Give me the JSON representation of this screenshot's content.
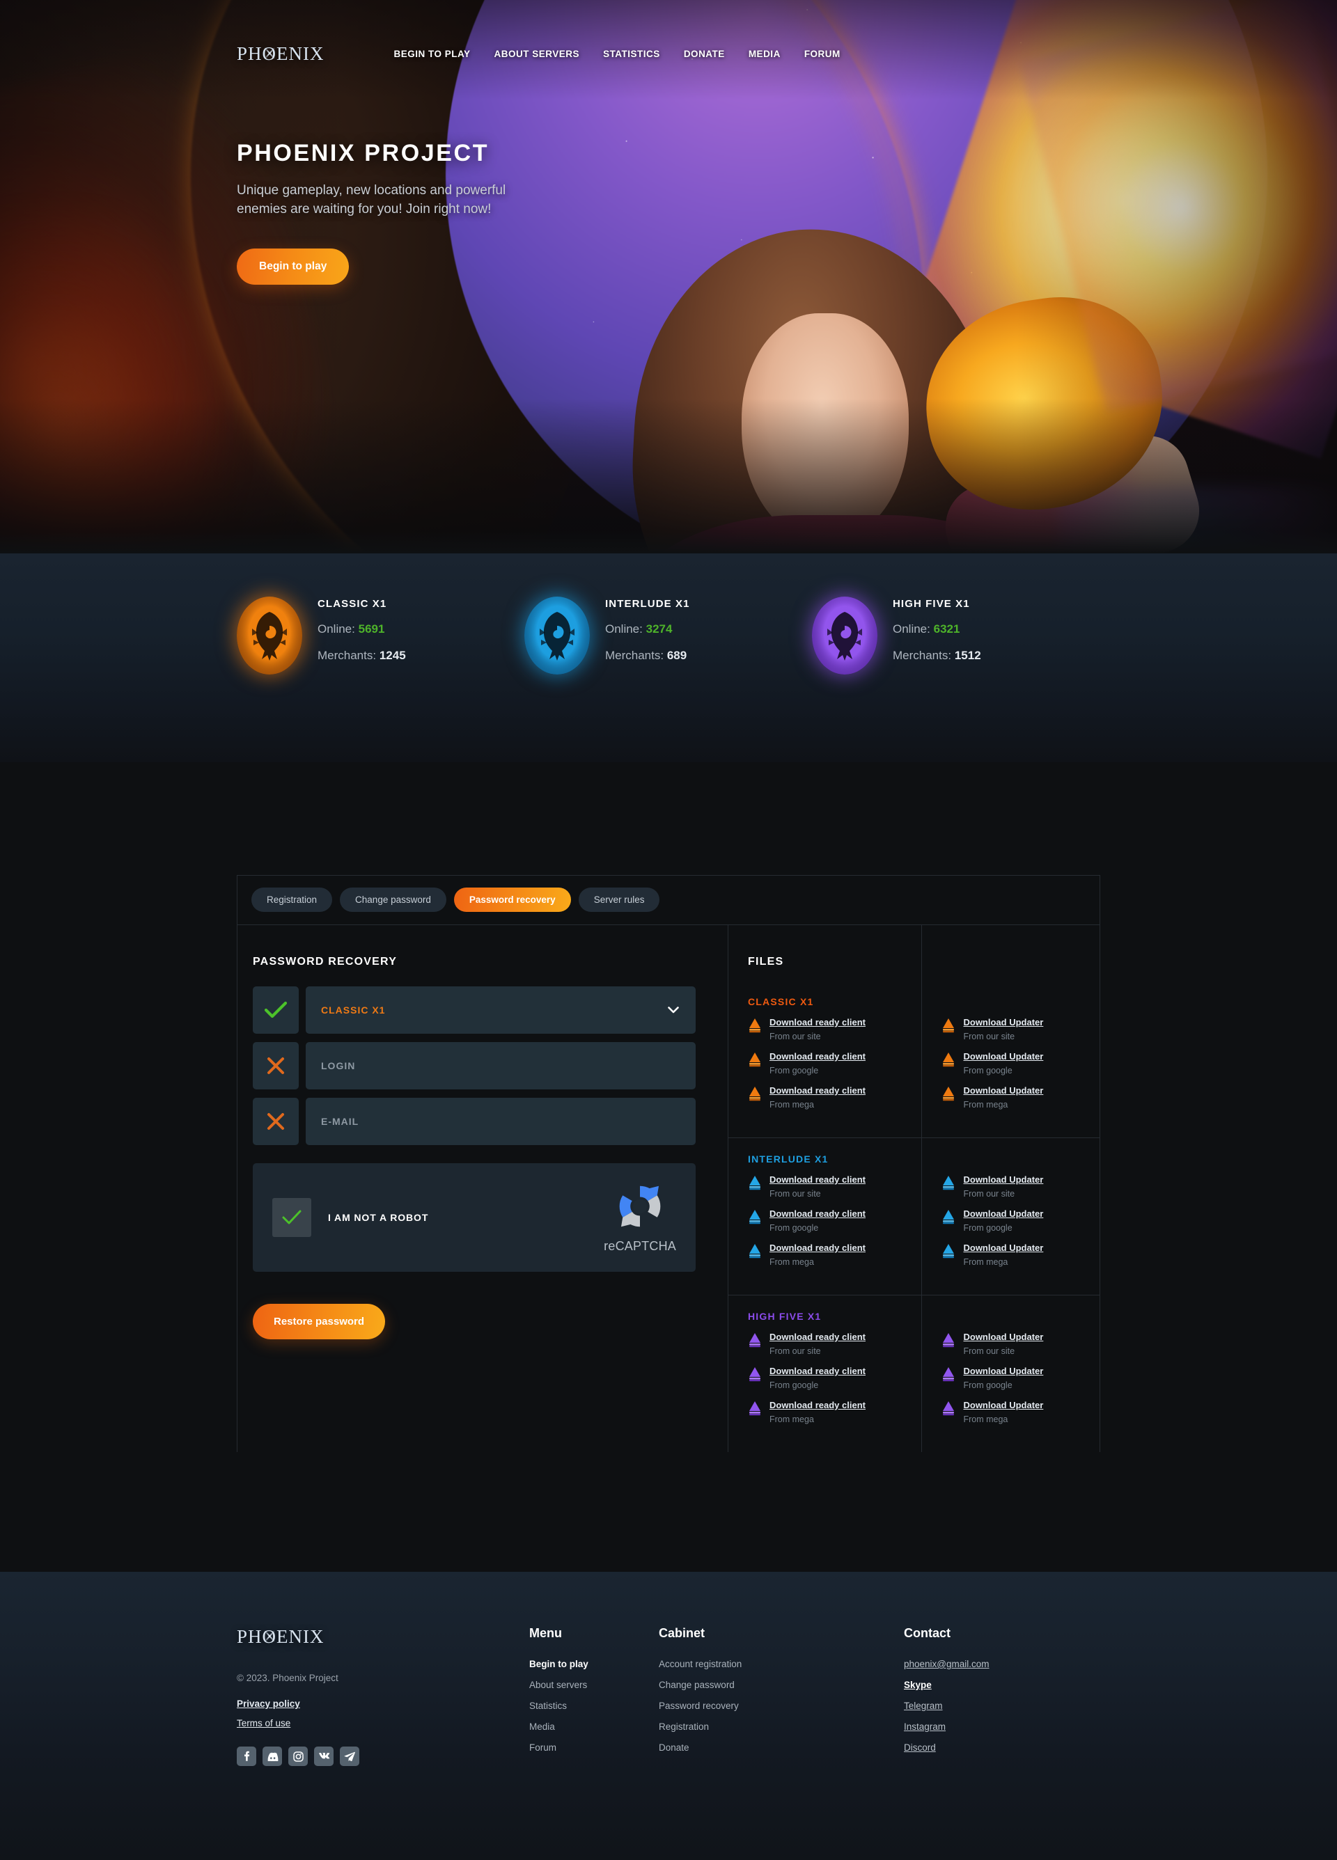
{
  "brand": {
    "logo_text": "PHOENIX"
  },
  "nav": {
    "items": [
      {
        "label": "BEGIN TO PLAY"
      },
      {
        "label": "ABOUT SERVERS"
      },
      {
        "label": "STATISTICS"
      },
      {
        "label": "DONATE"
      },
      {
        "label": "MEDIA"
      },
      {
        "label": "FORUM"
      }
    ]
  },
  "hero": {
    "title": "PHOENIX PROJECT",
    "subtitle": "Unique gameplay, new locations and powerful enemies are waiting for you! Join right now!",
    "cta_label": "Begin to play"
  },
  "servers": [
    {
      "name": "CLASSIC X1",
      "online_label": "Online:",
      "online": "5691",
      "merchants_label": "Merchants:",
      "merchants": "1245",
      "color": "#f07c13"
    },
    {
      "name": "INTERLUDE X1",
      "online_label": "Online:",
      "online": "3274",
      "merchants_label": "Merchants:",
      "merchants": "689",
      "color": "#1e9fe0"
    },
    {
      "name": "HIGH FIVE X1",
      "online_label": "Online:",
      "online": "6321",
      "merchants_label": "Merchants:",
      "merchants": "1512",
      "color": "#9356ed"
    }
  ],
  "tabs": [
    {
      "label": "Registration",
      "active": false
    },
    {
      "label": "Change password",
      "active": false
    },
    {
      "label": "Password recovery",
      "active": true
    },
    {
      "label": "Server rules",
      "active": false
    }
  ],
  "form": {
    "title": "PASSWORD RECOVERY",
    "server_field": {
      "value": "CLASSIC X1",
      "status": "valid"
    },
    "login_field": {
      "placeholder": "LOGIN",
      "value": "",
      "status": "invalid"
    },
    "email_field": {
      "placeholder": "E-MAIL",
      "value": "",
      "status": "invalid"
    },
    "captcha": {
      "label": "I AM NOT A ROBOT",
      "brand": "reCAPTCHA",
      "checked": true
    },
    "submit_label": "Restore password"
  },
  "files": {
    "title": "FILES",
    "groups": [
      {
        "name": "CLASSIC X1",
        "color": "#ef5a10",
        "client": [
          {
            "link": "Download ready client",
            "source": "From our site"
          },
          {
            "link": "Download ready client",
            "source": "From google"
          },
          {
            "link": "Download ready client",
            "source": "From mega"
          }
        ],
        "updater": [
          {
            "link": "Download Updater",
            "source": "From our site"
          },
          {
            "link": "Download Updater",
            "source": "From google"
          },
          {
            "link": "Download Updater",
            "source": "From mega"
          }
        ]
      },
      {
        "name": "INTERLUDE X1",
        "color": "#1e9fe0",
        "client": [
          {
            "link": "Download ready client",
            "source": "From our site"
          },
          {
            "link": "Download ready client",
            "source": "From google"
          },
          {
            "link": "Download ready client",
            "source": "From mega"
          }
        ],
        "updater": [
          {
            "link": "Download Updater",
            "source": "From our site"
          },
          {
            "link": "Download Updater",
            "source": "From google"
          },
          {
            "link": "Download Updater",
            "source": "From mega"
          }
        ]
      },
      {
        "name": "HIGH FIVE X1",
        "color": "#8b4ceb",
        "client": [
          {
            "link": "Download ready client",
            "source": "From our site"
          },
          {
            "link": "Download ready client",
            "source": "From google"
          },
          {
            "link": "Download ready client",
            "source": "From mega"
          }
        ],
        "updater": [
          {
            "link": "Download Updater",
            "source": "From our site"
          },
          {
            "link": "Download Updater",
            "source": "From google"
          },
          {
            "link": "Download Updater",
            "source": "From mega"
          }
        ]
      }
    ]
  },
  "footer": {
    "logo_text": "PHOENIX",
    "copyright": "© 2023. Phoenix Project",
    "legal": [
      {
        "label": "Privacy policy",
        "bold": true
      },
      {
        "label": "Terms of use",
        "bold": false
      }
    ],
    "socials": [
      {
        "name": "facebook-icon"
      },
      {
        "name": "discord-icon"
      },
      {
        "name": "instagram-icon"
      },
      {
        "name": "vk-icon"
      },
      {
        "name": "telegram-icon"
      }
    ],
    "menu": {
      "title": "Menu",
      "items": [
        {
          "label": "Begin to play",
          "bold": true
        },
        {
          "label": "About servers",
          "bold": false
        },
        {
          "label": "Statistics",
          "bold": false
        },
        {
          "label": "Media",
          "bold": false
        },
        {
          "label": "Forum",
          "bold": false
        }
      ]
    },
    "cabinet": {
      "title": "Cabinet",
      "items": [
        {
          "label": "Account registration",
          "bold": false
        },
        {
          "label": "Change password",
          "bold": false
        },
        {
          "label": "Password recovery",
          "bold": false
        },
        {
          "label": "Registration",
          "bold": false
        },
        {
          "label": "Donate",
          "bold": false
        }
      ]
    },
    "contact": {
      "title": "Contact",
      "items": [
        {
          "label": "phoenix@gmail.com",
          "bold": false
        },
        {
          "label": "Skype",
          "bold": true
        },
        {
          "label": "Telegram",
          "bold": false
        },
        {
          "label": "Instagram",
          "bold": false
        },
        {
          "label": "Discord",
          "bold": false
        }
      ]
    }
  },
  "colors": {
    "accent_orange": "#f58b16",
    "online_green": "#4eb32a",
    "panel_bg": "#223039"
  }
}
